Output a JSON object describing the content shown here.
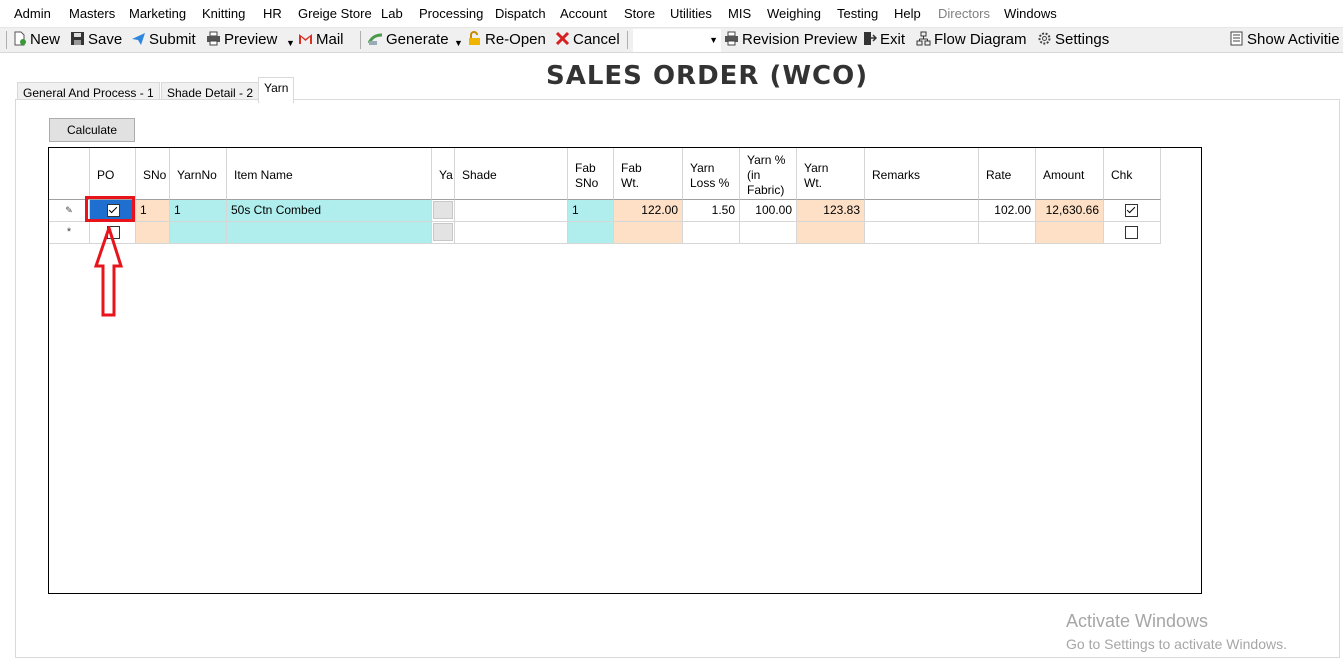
{
  "menu": [
    "Admin",
    "Masters",
    "Marketing",
    "Knitting",
    "HR",
    "Greige Store",
    "Lab",
    "Processing",
    "Dispatch",
    "Account",
    "Store",
    "Utilities",
    "MIS",
    "Weighing",
    "Testing",
    "Help",
    "Directors",
    "Windows"
  ],
  "toolbar": {
    "new": "New",
    "save": "Save",
    "submit": "Submit",
    "preview": "Preview",
    "mail": "Mail",
    "generate": "Generate",
    "reopen": "Re-Open",
    "cancel": "Cancel",
    "revision_preview": "Revision Preview",
    "exit": "Exit",
    "flow_diagram": "Flow Diagram",
    "settings": "Settings",
    "show_activities": "Show Activitie"
  },
  "page_title": "SALES ORDER (WCO)",
  "tabs": [
    "General And Process - 1",
    "Shade Detail - 2",
    "Yarn"
  ],
  "calculate_label": "Calculate",
  "columns": {
    "po": "PO",
    "sno": "SNo",
    "yarnno": "YarnNo",
    "item_name": "Item Name",
    "ya": "Ya",
    "shade": "Shade",
    "fab_sno": "Fab SNo",
    "fab_wt": "Fab Wt.",
    "yarn_loss": "Yarn Loss %",
    "yarn_pct": "Yarn % (in Fabric)",
    "yarn_wt": "Yarn Wt.",
    "remarks": "Remarks",
    "rate": "Rate",
    "amount": "Amount",
    "chk": "Chk"
  },
  "rows": [
    {
      "po_checked": true,
      "sno": "1",
      "yarnno": "1",
      "item_name": "50s Ctn Combed",
      "shade": "",
      "fab_sno": "1",
      "fab_wt": "122.00",
      "yarn_loss": "1.50",
      "yarn_pct": "100.00",
      "yarn_wt": "123.83",
      "remarks": "",
      "rate": "102.00",
      "amount": "12,630.66",
      "chk": true
    }
  ],
  "watermark": {
    "line1": "Activate Windows",
    "line2": "Go to Settings to activate Windows."
  }
}
